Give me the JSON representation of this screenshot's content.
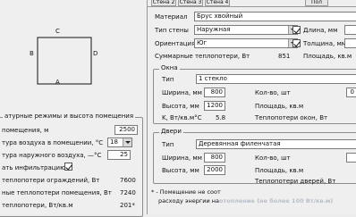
{
  "diagram": {
    "top": "C",
    "left": "B",
    "right": "D",
    "bottom": "A"
  },
  "left_panel": {
    "group_title": "атурные режимы и высота помещения",
    "rows": [
      {
        "label": "помещения, м",
        "value": "2500"
      },
      {
        "label": "турa воздуха в помещении, °C",
        "value": "18"
      },
      {
        "label": "турa наружного воздуха, —°C",
        "value": "25"
      }
    ],
    "infiltration_label": "ать инфильтрацию",
    "totals": [
      {
        "label": "теплопотери ограждений, Вт",
        "value": "7600"
      },
      {
        "label": "ные теплопотери помещения, Вт",
        "value": "7240"
      },
      {
        "label": "теплопотери, Вт/кв.м",
        "value": "201*"
      }
    ]
  },
  "tabs": [
    "Стена 2",
    "Стена 3",
    "Стена 4",
    "Пол"
  ],
  "wall": {
    "material_label": "Материал",
    "material_value": "Брус хвойный",
    "type_label": "Тип стены",
    "type_value": "Наружная",
    "length_label": "Длина, мм",
    "orientation_label": "Ориентация",
    "orientation_value": "Юг",
    "thickness_label": "Толщина, мм",
    "sum_label": "Суммарные теплопотери, Вт",
    "sum_value": "851",
    "area_label": "Площадь, кв.м"
  },
  "windows": {
    "title": "Окна",
    "type_label": "Тип",
    "type_value": "1 стекло",
    "width_label": "Ширина, мм",
    "width_value": "800",
    "count_label": "Кол-во, шт",
    "count_value": "0",
    "height_label": "Высота, мм",
    "height_value": "1200",
    "area_label": "Площадь, кв.м",
    "k_label": "K, Вт/кв.м°C",
    "k_value": "5.8",
    "loss_label": "Теплопотери окон, Вт"
  },
  "doors": {
    "title": "Двери",
    "type_label": "Тип",
    "type_value": "Деревянная филенчатая",
    "width_label": "Ширина, мм",
    "width_value": "800",
    "count_label": "Кол-во, шт",
    "height_label": "Высота, мм",
    "height_value": "2000",
    "area_label": "Площадь, кв.м",
    "loss_label": "Теплопотери дверей, Вт"
  },
  "note": {
    "line1": "* - Помещение не соот",
    "line2": "расходу энергии на",
    "watermark": "отопление (не более 100 Вт/кв.м)"
  }
}
